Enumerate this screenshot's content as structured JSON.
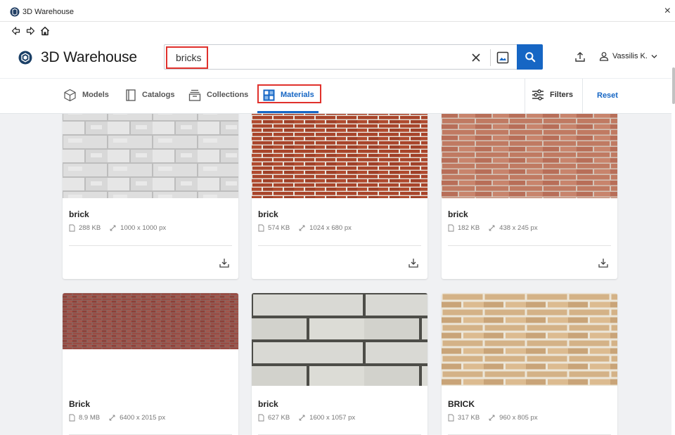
{
  "window": {
    "title": "3D Warehouse",
    "close_glyph": "×"
  },
  "nav": {
    "back_icon": "back-arrow-icon",
    "forward_icon": "forward-arrow-icon",
    "home_icon": "home-icon"
  },
  "header": {
    "brand": "3D Warehouse",
    "search_value": "bricks",
    "user_name": "Vassilis K."
  },
  "tabs": [
    {
      "label": "Models",
      "icon": "cube-icon",
      "active": false
    },
    {
      "label": "Catalogs",
      "icon": "catalog-icon",
      "active": false
    },
    {
      "label": "Collections",
      "icon": "collection-icon",
      "active": false
    },
    {
      "label": "Materials",
      "icon": "materials-icon",
      "active": true
    }
  ],
  "toolbar": {
    "filters": "Filters",
    "reset": "Reset"
  },
  "colors": {
    "accent": "#1666c4",
    "highlight": "#e0312c"
  },
  "cards": [
    {
      "name": "brick",
      "size": "288 KB",
      "dims": "1000 x 1000 px"
    },
    {
      "name": "brick",
      "size": "574 KB",
      "dims": "1024 x 680 px"
    },
    {
      "name": "brick",
      "size": "182 KB",
      "dims": "438 x 245 px"
    },
    {
      "name": "Brick",
      "size": "8.9 MB",
      "dims": "6400 x 2015 px"
    },
    {
      "name": "brick",
      "size": "627 KB",
      "dims": "1600 x 1057 px"
    },
    {
      "name": "BRICK",
      "size": "317 KB",
      "dims": "960 x 805 px"
    }
  ]
}
